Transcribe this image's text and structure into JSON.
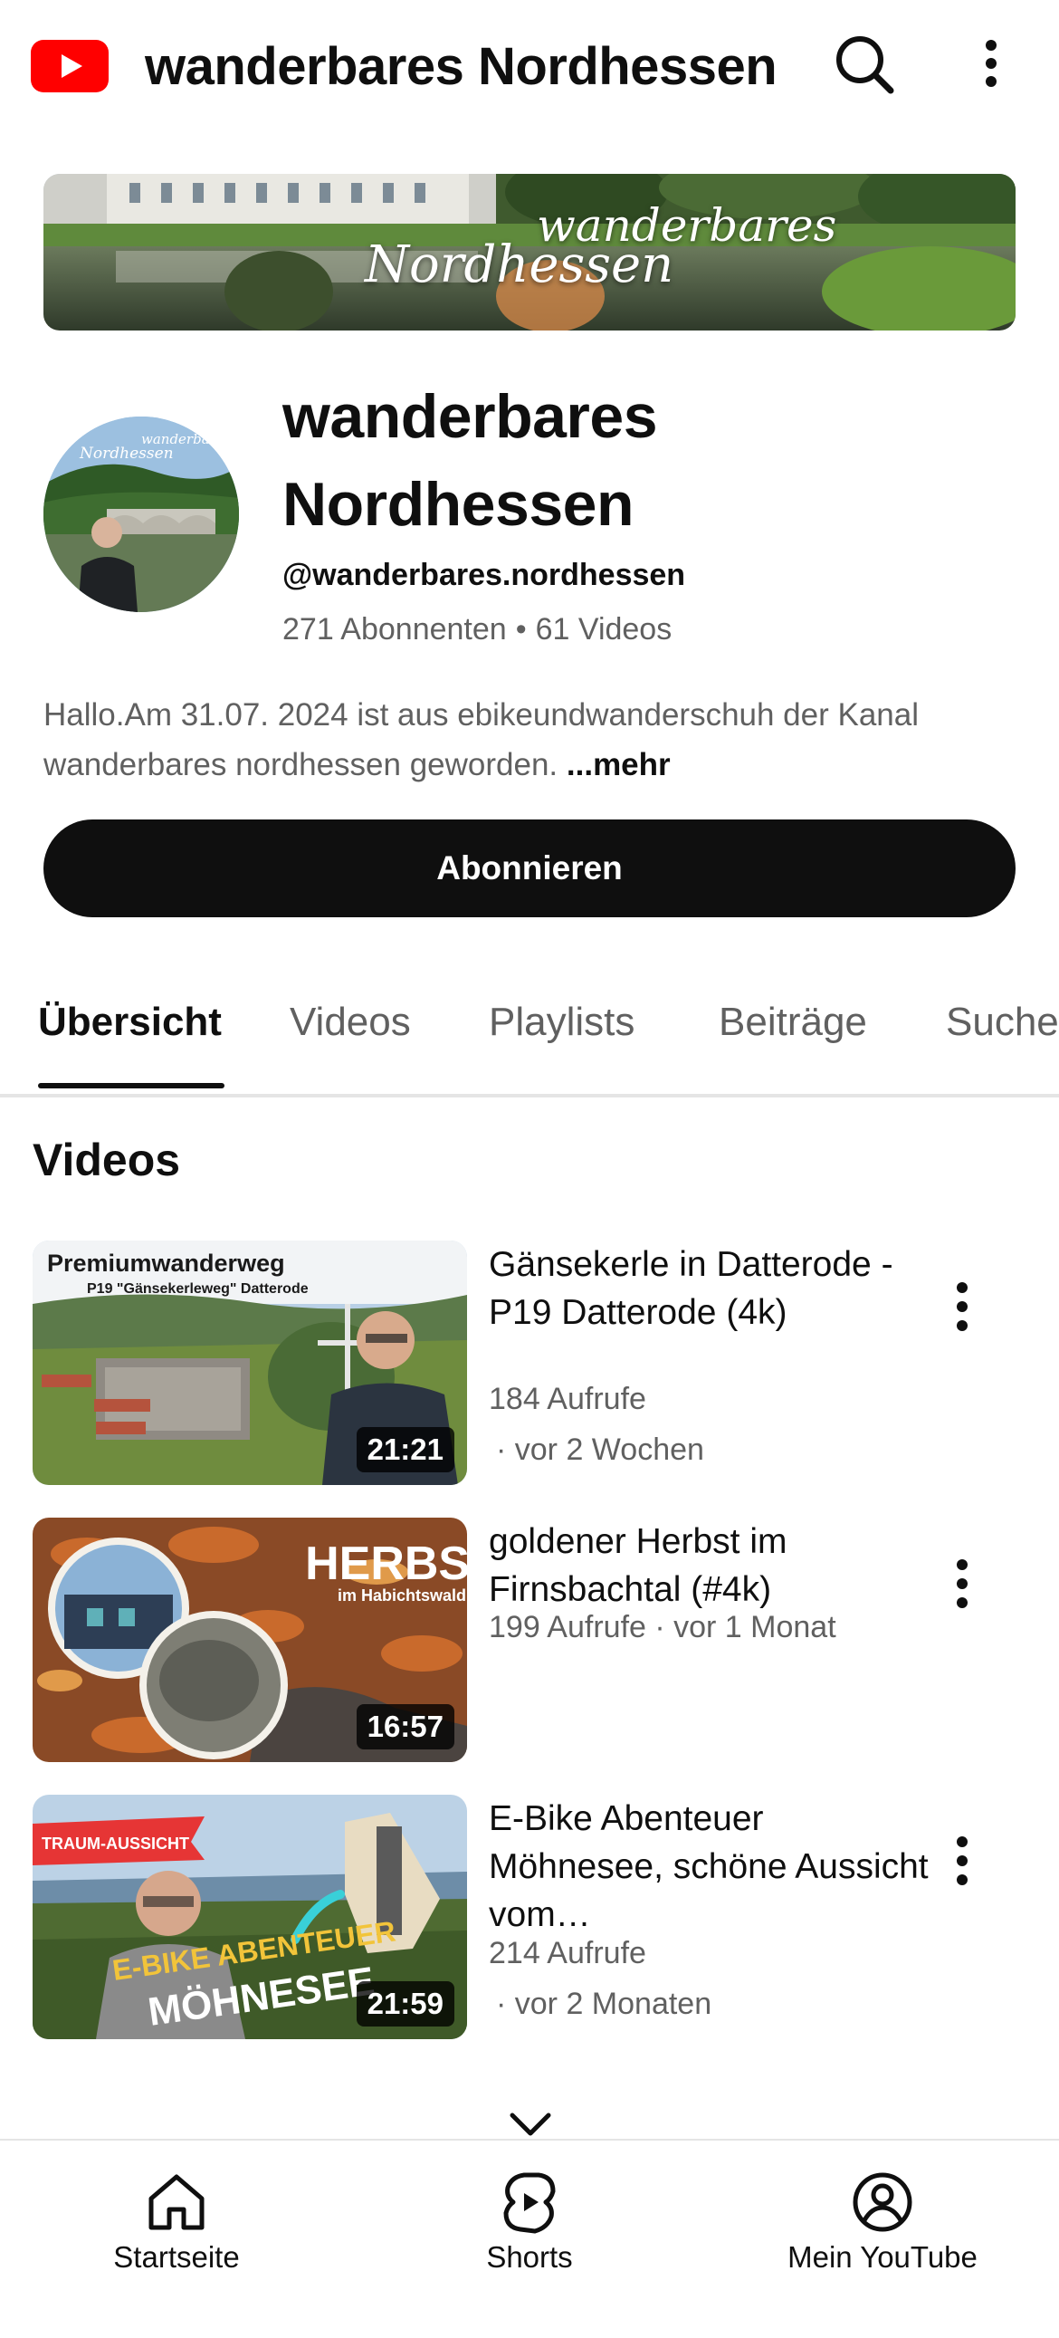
{
  "topbar": {
    "title": "wanderbares Nordhessen"
  },
  "banner": {
    "line1": "wanderbares",
    "line2": "Nordhessen"
  },
  "avatar": {
    "line1": "wanderbares",
    "line2": "Nordhessen"
  },
  "channel": {
    "name": "wanderbares Nordhessen",
    "handle": "@wanderbares.nordhessen",
    "subscribers": "271 Abonnenten",
    "videos": "61 Videos",
    "description": "Hallo.Am 31.07. 2024 ist aus ebikeundwanderschuh der Kanal wanderbares nordhessen geworden.",
    "more": "...mehr",
    "subscribe_label": "Abonnieren"
  },
  "tabs": [
    {
      "label": "Übersicht",
      "active": true
    },
    {
      "label": "Videos",
      "active": false
    },
    {
      "label": "Playlists",
      "active": false
    },
    {
      "label": "Beiträge",
      "active": false
    },
    {
      "label": "Suche",
      "active": false
    }
  ],
  "section": {
    "title": "Videos"
  },
  "videos": [
    {
      "title": "Gänsekerle in Datterode - P19 Datterode (4k)",
      "views": "184 Aufrufe",
      "date": "· vor 2 Wochen",
      "duration": "21:21",
      "thumb_title": "Premiumwanderweg",
      "thumb_subtitle": "P19 \"Gänsekerleweg\" Datterode"
    },
    {
      "title": "goldener Herbst im Firnsbachtal (#4k)",
      "views": "199 Aufrufe · vor 1 Monat",
      "date": "",
      "duration": "16:57",
      "thumb_title": "HERBST",
      "thumb_subtitle": "im Habichtswald"
    },
    {
      "title": "E-Bike Abenteuer Möhnesee, schöne Aussicht vom…",
      "views": "214 Aufrufe",
      "date": "· vor 2 Monaten",
      "duration": "21:59",
      "thumb_badge": "TRAUM-AUSSICHT",
      "thumb_title": "E-BIKE ABENTEUER",
      "thumb_subtitle": "MÖHNESEE"
    }
  ],
  "bottom_nav": [
    {
      "label": "Startseite",
      "icon": "home-icon"
    },
    {
      "label": "Shorts",
      "icon": "shorts-icon"
    },
    {
      "label": "Mein YouTube",
      "icon": "account-icon"
    }
  ],
  "colors": {
    "brand_red": "#ff0000",
    "text_primary": "#0f0f0f",
    "text_secondary": "#606060",
    "subscribe_bg": "#0f0f0f"
  }
}
